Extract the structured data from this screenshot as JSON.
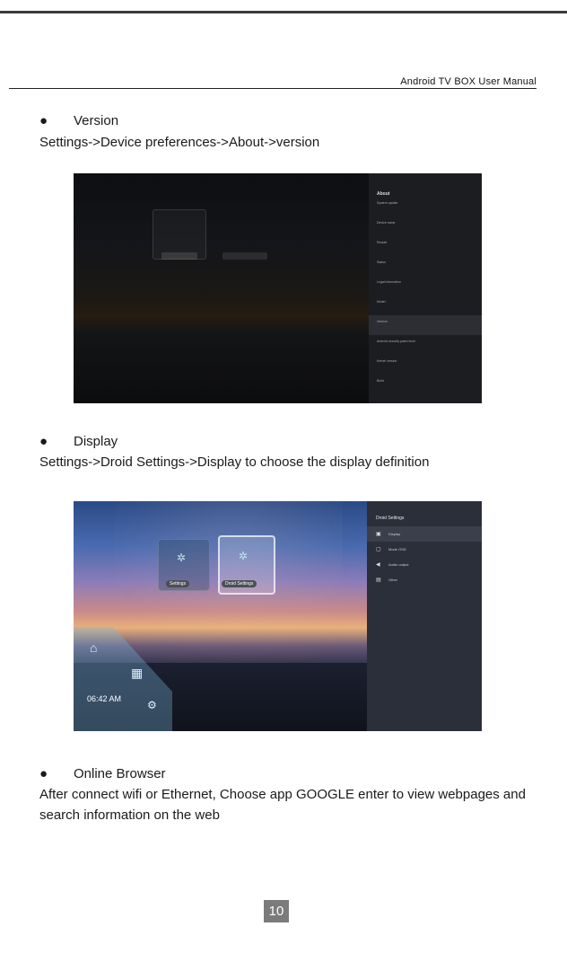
{
  "header": {
    "title": "Android TV BOX User Manual"
  },
  "sections": [
    {
      "bullet": "●",
      "heading": "Version",
      "text": "Settings->Device preferences->About->version"
    },
    {
      "bullet": "●",
      "heading": "Display",
      "text": "Settings->Droid Settings->Display to choose the display definition"
    },
    {
      "bullet": "●",
      "heading": "Online Browser",
      "text": "After connect wifi or Ethernet, Choose app GOOGLE enter to view webpages and search information on the web"
    }
  ],
  "screenshot_about": {
    "title": "About",
    "items": [
      "System update",
      "Device name",
      "Restart",
      "Status",
      "Legal information",
      "Model",
      "Version",
      "Android security patch level",
      "Kernel version",
      "Build"
    ]
  },
  "screenshot_droid": {
    "title": "Droid Settings",
    "items": [
      "Display",
      "Mode OSD",
      "Audio output",
      "Other"
    ],
    "tiles": [
      "Settings",
      "Droid Settings"
    ],
    "clock": "06:42 AM"
  },
  "page_number": "10"
}
